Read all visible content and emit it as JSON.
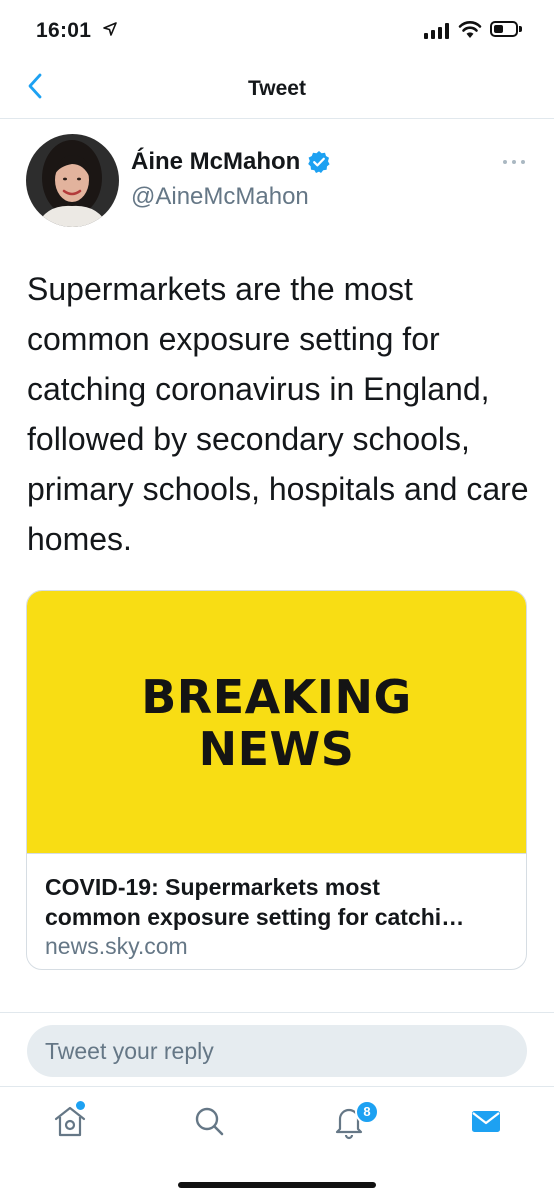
{
  "status_bar": {
    "time": "16:01",
    "icons": [
      "location-arrow-icon",
      "signal-icon",
      "wifi-icon",
      "battery-icon"
    ]
  },
  "nav": {
    "title": "Tweet",
    "back_icon": "chevron-left-icon"
  },
  "tweet": {
    "author_name": "Áine McMahon",
    "handle": "@AineMcMahon",
    "verified": true,
    "text": "Supermarkets are the most common exposure setting for catching coronavirus in England, followed by secondary schools, primary schools, hospitals and care homes.",
    "card": {
      "image_text_line1": "BREAKING",
      "image_text_line2": "NEWS",
      "title_line1": "COVID-19: Supermarkets most",
      "title_line2": "common exposure setting for catchi…",
      "domain": "news.sky.com"
    }
  },
  "reply": {
    "placeholder": "Tweet your reply"
  },
  "tab_bar": {
    "items": [
      "home-icon",
      "search-icon",
      "notifications-icon",
      "messages-icon"
    ],
    "notifications_count": "8"
  },
  "colors": {
    "accent": "#1da1f2",
    "card_image_bg": "#f8dd14",
    "secondary_text": "#657786"
  }
}
